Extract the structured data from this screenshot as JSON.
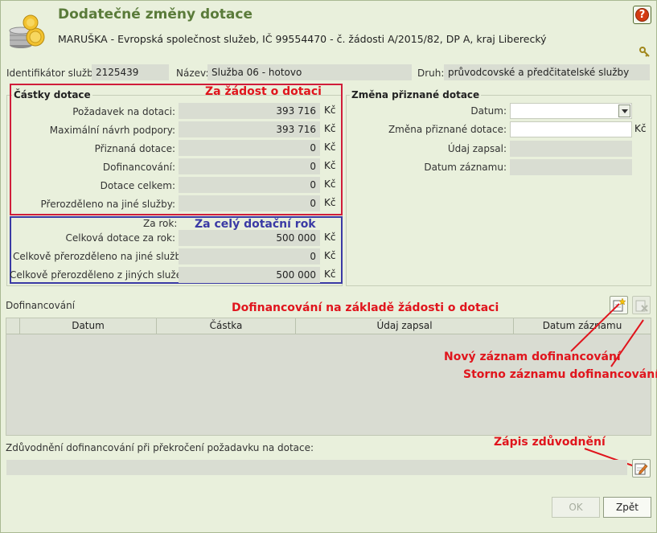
{
  "header": {
    "title": "Dodatečné změny dotace",
    "subtitle": "MARUŠKA - Evropská společnost služeb, IČ 99554470 - č. žádosti A/2015/82, DP A, kraj Liberecký",
    "help_label": "?"
  },
  "info": {
    "id_label": "Identifikátor služby:",
    "id_value": "2125439",
    "name_label": "Název:",
    "name_value": "Služba 06 - hotovo",
    "type_label": "Druh:",
    "type_value": "průvodcovské a předčitatelské služby"
  },
  "amounts": {
    "title": "Částky dotace",
    "currency": "Kč",
    "rows": [
      {
        "label": "Požadavek na dotaci:",
        "value": "393 716"
      },
      {
        "label": "Maximální návrh podpory:",
        "value": "393 716"
      },
      {
        "label": "Přiznaná dotace:",
        "value": "0"
      },
      {
        "label": "Dofinancování:",
        "value": "0"
      },
      {
        "label": "Dotace celkem:",
        "value": "0"
      },
      {
        "label": "Přerozděleno na jiné služby:",
        "value": "0"
      }
    ],
    "year_label": "Za rok:",
    "year_rows": [
      {
        "label": "Celková dotace za rok:",
        "value": "500 000"
      },
      {
        "label": "Celkově přerozděleno na jiné služby:",
        "value": "0"
      },
      {
        "label": "Celkově přerozděleno z jiných služeb:",
        "value": "500 000"
      }
    ]
  },
  "change": {
    "title": "Změna přiznané dotace",
    "date_label": "Datum:",
    "amount_label": "Změna přiznané dotace:",
    "amount_currency": "Kč",
    "recorded_by_label": "Údaj zapsal:",
    "record_date_label": "Datum záznamu:"
  },
  "cofinancing": {
    "section_label": "Dofinancování",
    "columns": [
      "Datum",
      "Částka",
      "Údaj zapsal",
      "Datum záznamu"
    ]
  },
  "justification": {
    "label": "Zdůvodnění dofinancování při překročení požadavku na dotace:"
  },
  "annotations": {
    "za_zadost": "Za žádost o dotaci",
    "za_rok": "Za celý dotační rok",
    "dofin_zadost": "Dofinancování na základě žádosti o dotaci",
    "novy_zaznam": "Nový záznam dofinancování",
    "storno": "Storno záznamu dofinancování",
    "zapis": "Zápis zdůvodnění"
  },
  "buttons": {
    "ok": "OK",
    "back": "Zpět"
  },
  "colors": {
    "title": "#5a7b3a",
    "annotation_red": "#e0151d",
    "annotation_blue": "#3a3aa5"
  }
}
